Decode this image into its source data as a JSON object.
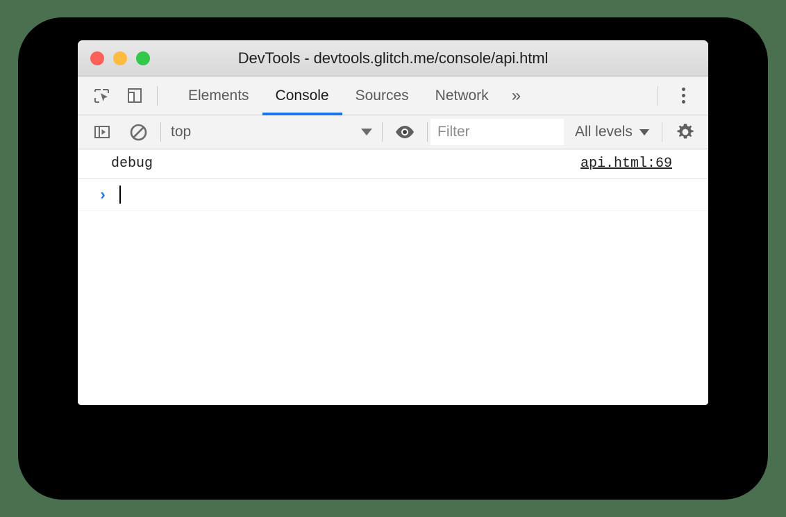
{
  "window": {
    "title": "DevTools - devtools.glitch.me/console/api.html",
    "traffic_lights": {
      "close": "close-window",
      "minimize": "minimize-window",
      "maximize": "maximize-window"
    }
  },
  "colors": {
    "page_background": "#4a7050",
    "backdrop": "#000000",
    "accent_blue": "#1a73e8",
    "toolbar_background": "#f3f3f3",
    "close_dot": "#fc6058",
    "minimize_dot": "#fdbc40",
    "maximize_dot": "#34c84a"
  },
  "tabbar": {
    "inspect_icon": "inspect-element-icon",
    "device_icon": "device-toolbar-icon",
    "tabs": [
      {
        "label": "Elements",
        "active": false
      },
      {
        "label": "Console",
        "active": true
      },
      {
        "label": "Sources",
        "active": false
      },
      {
        "label": "Network",
        "active": false
      }
    ],
    "more_tabs_label": "»",
    "more_options_icon": "kebab-menu-icon"
  },
  "filterbar": {
    "sidebar_toggle_icon": "console-sidebar-icon",
    "clear_console_icon": "clear-console-icon",
    "context_value": "top",
    "context_caret_icon": "chevron-down-icon",
    "live_expression_icon": "eye-icon",
    "filter_placeholder": "Filter",
    "filter_value": "",
    "levels_label": "All levels",
    "levels_caret_icon": "chevron-down-icon",
    "settings_icon": "gear-icon"
  },
  "console": {
    "messages": [
      {
        "text": "debug",
        "source": "api.html:69"
      }
    ],
    "prompt_symbol": "›",
    "prompt_value": ""
  }
}
